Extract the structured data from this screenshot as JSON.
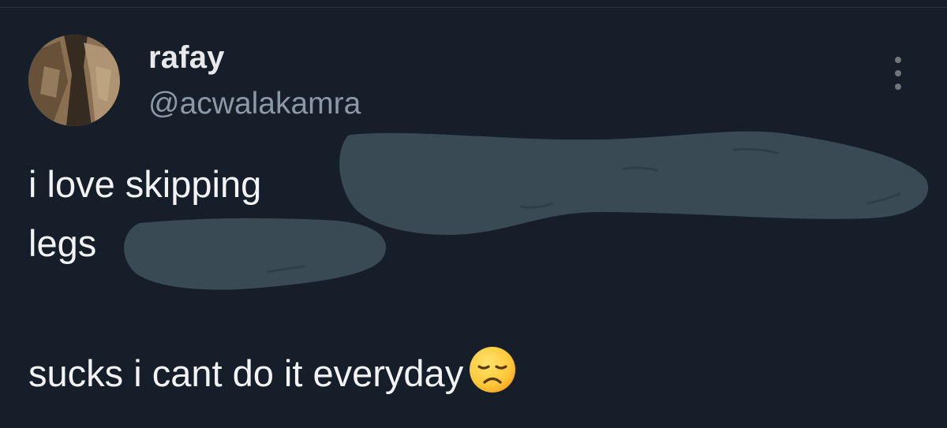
{
  "tweet": {
    "display_name": "rafay",
    "handle": "@acwalakamra",
    "lines": [
      "i love skipping",
      "legs",
      "sucks i cant do it everyday"
    ],
    "emoji": "disappointed-face"
  },
  "colors": {
    "background": "#161e2a",
    "text": "#f1f3f4",
    "secondary_text": "#8b98a5",
    "redaction": "#3a4a55"
  },
  "icons": {
    "more": "more-vertical-icon",
    "emoji": "disappointed-face-icon"
  }
}
